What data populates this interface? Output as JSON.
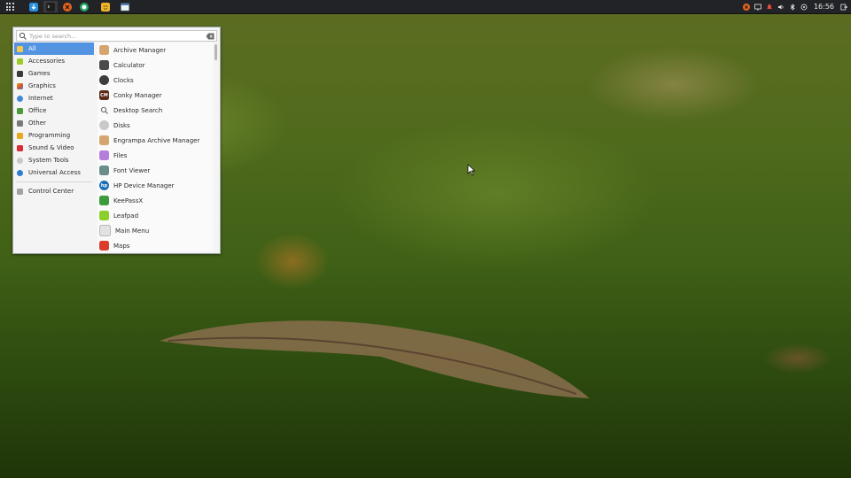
{
  "panel": {
    "clock": "16:56",
    "launchers": [
      {
        "name": "apps-menu-button",
        "icon": "grid-icon"
      },
      {
        "name": "downloads",
        "icon": "download-arrow-icon",
        "color": "#2a8fdc"
      },
      {
        "name": "terminal",
        "icon": "terminal-icon",
        "color": "#2a2a2a"
      },
      {
        "name": "xampp",
        "icon": "xampp-icon",
        "color": "#e8641b"
      },
      {
        "name": "hangouts",
        "icon": "chat-bubble-icon",
        "color": "#22a463"
      },
      {
        "name": "emoji-app",
        "icon": "smiley-icon",
        "color": "#f0b429"
      },
      {
        "name": "window",
        "icon": "window-icon",
        "color": "#d9e4f0"
      }
    ],
    "tray_icons": [
      "xampp-tray-icon",
      "display-icon",
      "notification-icon",
      "volume-icon",
      "bluetooth-icon",
      "power-icon"
    ]
  },
  "menu": {
    "search_placeholder": "Type to search...",
    "categories": [
      {
        "label": "All",
        "color": "#f2c94c",
        "selected": true
      },
      {
        "label": "Accessories",
        "color": "#9ccc2a"
      },
      {
        "label": "Games",
        "color": "#3b3b3b"
      },
      {
        "label": "Graphics",
        "color": "#d3572e"
      },
      {
        "label": "Internet",
        "color": "#3f88d8"
      },
      {
        "label": "Office",
        "color": "#4c9a3b"
      },
      {
        "label": "Other",
        "color": "#7a7a7a"
      },
      {
        "label": "Programming",
        "color": "#e6a81f"
      },
      {
        "label": "Sound & Video",
        "color": "#d92e3a"
      },
      {
        "label": "System Tools",
        "color": "#c8c8c8"
      },
      {
        "label": "Universal Access",
        "color": "#2f7cd3"
      }
    ],
    "control_center": {
      "label": "Control Center",
      "color": "#a2a2a2"
    },
    "apps": [
      {
        "label": "Archive Manager",
        "color": "#d6a46e",
        "icon": "archive-icon"
      },
      {
        "label": "Calculator",
        "color": "#4a4a4a",
        "icon": "calculator-icon"
      },
      {
        "label": "Clocks",
        "color": "#3d3d3d",
        "icon": "clock-icon"
      },
      {
        "label": "Conky Manager",
        "color": "#5a2a1a",
        "icon": "conky-icon",
        "glyph": "CM"
      },
      {
        "label": "Desktop Search",
        "color": "#f5f5f5",
        "icon": "search-icon"
      },
      {
        "label": "Disks",
        "color": "#c9c9c9",
        "icon": "disk-icon"
      },
      {
        "label": "Engrampa Archive Manager",
        "color": "#d6a46e",
        "icon": "archive-icon"
      },
      {
        "label": "Files",
        "color": "#b57edc",
        "icon": "folder-icon"
      },
      {
        "label": "Font Viewer",
        "color": "#6a8e8a",
        "icon": "font-icon"
      },
      {
        "label": "HP Device Manager",
        "color": "#1a6fb5",
        "icon": "hp-icon",
        "glyph": "hp"
      },
      {
        "label": "KeePassX",
        "color": "#3c9b3c",
        "icon": "key-icon"
      },
      {
        "label": "Leafpad",
        "color": "#8ccf2a",
        "icon": "notepad-icon"
      },
      {
        "label": "Main Menu",
        "color": "#e2e2e2",
        "icon": "menu-icon"
      },
      {
        "label": "Maps",
        "color": "#dc3c2c",
        "icon": "map-pin-icon"
      }
    ]
  }
}
